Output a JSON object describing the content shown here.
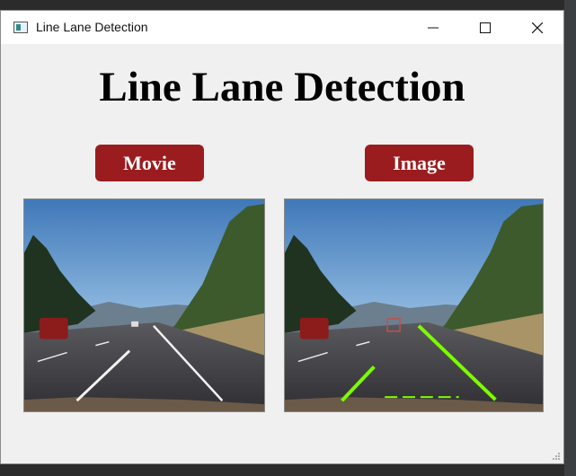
{
  "window": {
    "title": "Line Lane Detection"
  },
  "heading": "Line Lane Detection",
  "buttons": {
    "movie": "Movie",
    "image": "Image"
  },
  "colors": {
    "button_bg": "#9b1c1f",
    "lane_highlight": "#7cfc00",
    "window_bg": "#f0f0f0"
  },
  "icons": {
    "app": "app-window-icon",
    "minimize": "minimize-icon",
    "maximize": "maximize-icon",
    "close": "close-icon"
  },
  "views": {
    "left": "original-road-image",
    "right": "lane-detected-road-image"
  }
}
